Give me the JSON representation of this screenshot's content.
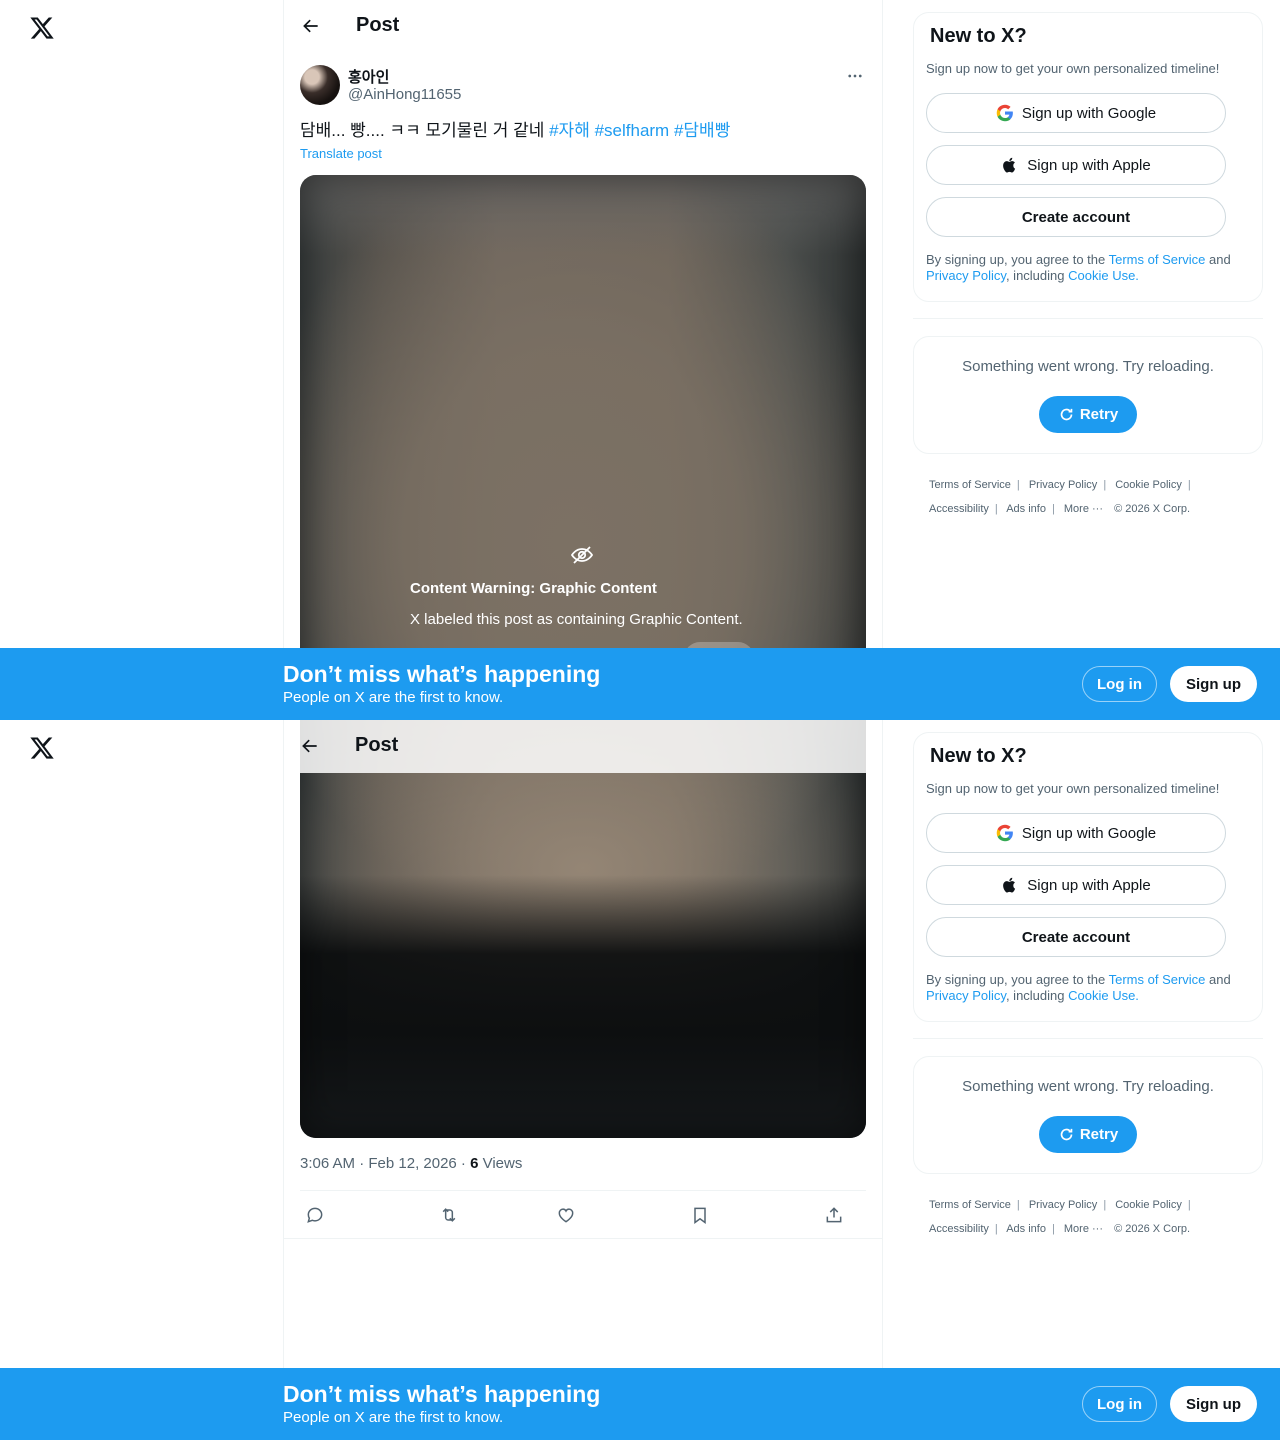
{
  "nav": {
    "logo_icon": "x-logo-icon"
  },
  "header": {
    "title": "Post",
    "back_icon": "arrow-left-icon"
  },
  "post": {
    "author_name": "홍아인",
    "author_handle": "@AinHong11655",
    "text": "담배... 빵.... ㅋㅋ 모기물린 거 같네",
    "hashtags": [
      "#자해",
      "#selfharm",
      "#담배빵"
    ],
    "translate_label": "Translate post",
    "warning_title": "Content Warning: Graphic Content",
    "warning_text": "X labeled this post as containing Graphic Content.",
    "time": "3:06 AM · Feb 12, 2026 · ",
    "views_count": "6",
    "views_label": " Views"
  },
  "actions": [
    "reply-icon",
    "repost-icon",
    "like-icon",
    "bookmark-icon",
    "share-icon"
  ],
  "sidebar": {
    "signup_title": "New to X?",
    "signup_sub": "Sign up now to get your own personalized timeline!",
    "google_label": "Sign up with Google",
    "apple_label": "Sign up with Apple",
    "create_label": "Create account",
    "legal_prefix": "By signing up, you agree to the ",
    "legal_tos": "Terms of Service",
    "legal_and": " and",
    "legal_privacy": "Privacy Policy",
    "legal_including": ", including ",
    "legal_cookie": "Cookie Use.",
    "error_text": "Something went wrong. Try reloading.",
    "retry_label": "Retry"
  },
  "footer": {
    "tos": "Terms of Service",
    "privacy": "Privacy Policy",
    "cookie": "Cookie Policy",
    "accessibility": "Accessibility",
    "ads": "Ads info",
    "more": "More ···",
    "copyright": "© 2026 X Corp."
  },
  "banner": {
    "title": "Don’t miss what’s happening",
    "subtitle": "People on X are the first to know.",
    "login_label": "Log in",
    "signup_label": "Sign up"
  },
  "colors": {
    "accent": "#1d9bf0",
    "text": "#0f1419",
    "muted": "#536471",
    "border": "#eff3f4"
  }
}
